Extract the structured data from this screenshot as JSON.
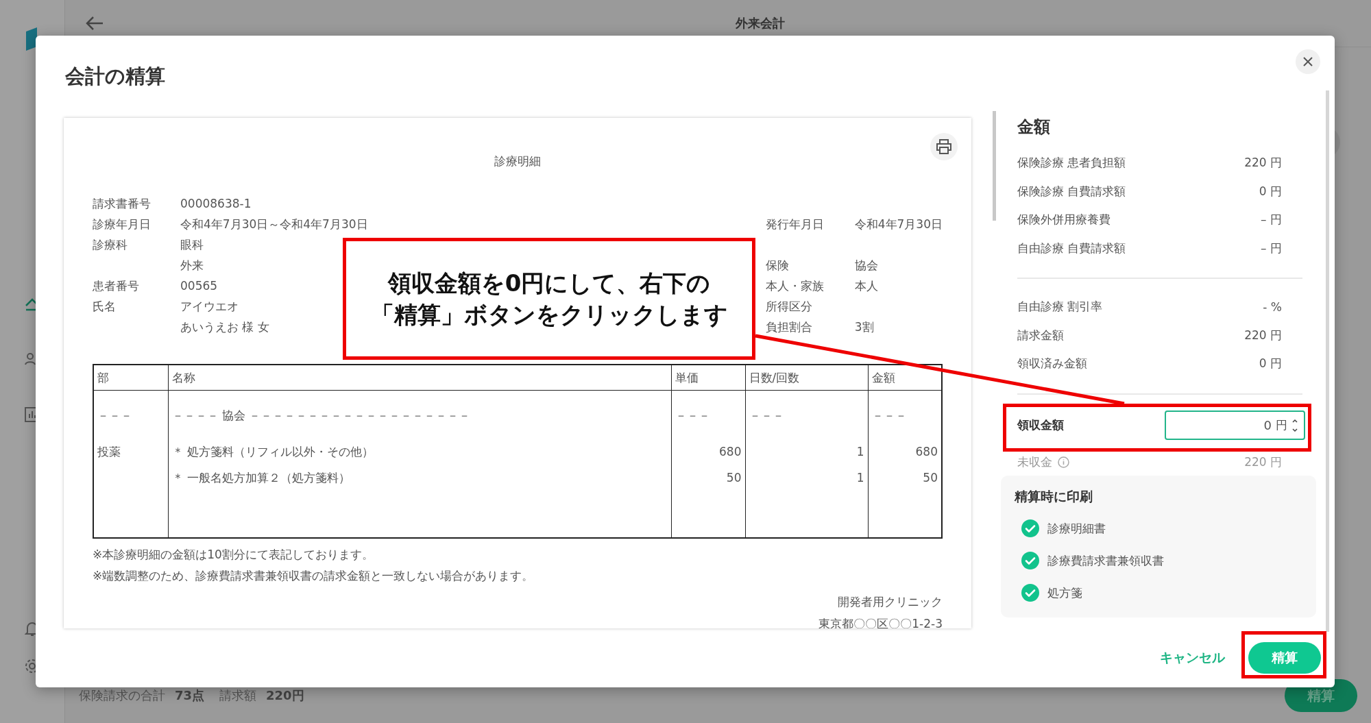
{
  "app": {
    "title": "外来会計",
    "footer": {
      "points_label": "保険請求の合計",
      "points": "73点",
      "amount_label": "請求額",
      "amount": "220円",
      "button": "精算"
    }
  },
  "dialog": {
    "title": "会計の精算",
    "statement": {
      "title": "診療明細",
      "info_left": [
        {
          "label": "請求書番号",
          "value": "00008638-1"
        },
        {
          "label": "診療年月日",
          "value": "令和4年7月30日～令和4年7月30日"
        },
        {
          "label": "診療科",
          "value": "眼科"
        },
        {
          "value": "外来"
        },
        {
          "label": "患者番号",
          "value": "00565"
        },
        {
          "label": "氏名",
          "value": "アイウエオ"
        },
        {
          "value": "あいうえお 様 女"
        }
      ],
      "info_right": [
        {
          "label": "発行年月日",
          "value": "令和4年7月30日"
        },
        {
          "label": "保険",
          "value": "協会"
        },
        {
          "label": "本人・家族",
          "value": "本人"
        },
        {
          "label": "所得区分"
        },
        {
          "label": "負担割合",
          "value": "3割"
        }
      ],
      "table": {
        "columns": [
          "部",
          "名称",
          "単価",
          "日数/回数",
          "金額"
        ],
        "rows": [
          [
            "－－－",
            "－－－－ 協会 －－－－－－－－－－－－－－－－－－－",
            "－－－",
            "－－－",
            "－－－"
          ],
          [
            "投薬",
            "＊ 処方箋料（リフィル以外・その他）",
            "680",
            "1",
            "680"
          ],
          [
            "",
            "＊ 一般名処方加算２（処方箋料）",
            "50",
            "1",
            "50"
          ]
        ]
      },
      "notes": [
        "※本診療明細の金額は10割分にて表記しております。",
        "※端数調整のため、診療費請求書兼領収書の請求金額と一致しない場合があります。"
      ],
      "issuer": [
        "開発者用クリニック",
        "東京都〇〇区〇〇1-2-3"
      ]
    },
    "amounts": {
      "title": "金額",
      "group_1": [
        {
          "label": "保険診療 患者負担額",
          "value": "220 円"
        },
        {
          "label": "保険診療 自費請求額",
          "value": "0 円"
        },
        {
          "label": "保険外併用療養費",
          "value": "– 円"
        },
        {
          "label": "自由診療 自費請求額",
          "value": "– 円"
        }
      ],
      "group_2": [
        {
          "label": "自由診療 割引率",
          "value": "- %"
        },
        {
          "label": "請求金額",
          "value": "220 円"
        },
        {
          "label": "領収済み金額",
          "value": "0 円"
        }
      ],
      "received": {
        "label": "領収金額",
        "value": "0",
        "unit": "円"
      },
      "unpaid": {
        "label": "未収金",
        "value": "220 円"
      }
    },
    "print_options": {
      "title": "精算時に印刷",
      "items": [
        {
          "label": "診療明細書",
          "checked": true
        },
        {
          "label": "診療費請求書兼領収書",
          "checked": true
        },
        {
          "label": "処方箋",
          "checked": true
        }
      ]
    },
    "buttons": {
      "cancel": "キャンセル",
      "submit": "精算"
    }
  },
  "annotation": {
    "lines": [
      "領収金額を0円にして、右下の",
      "「精算」ボタンをクリックします"
    ]
  }
}
